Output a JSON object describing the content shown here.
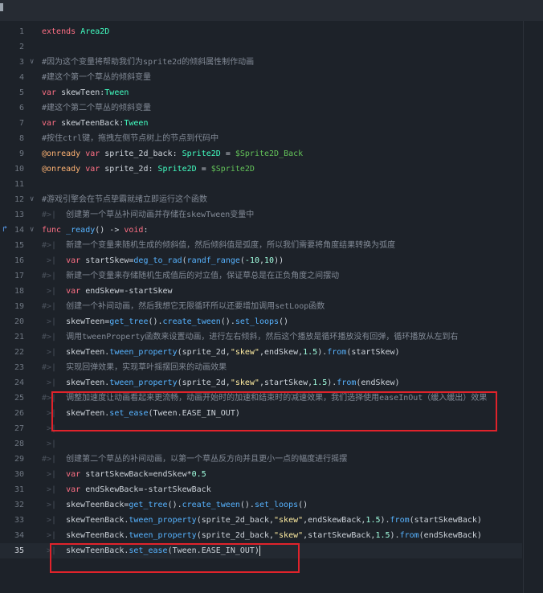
{
  "colors": {
    "background": "#1d2229",
    "keyword": "#ff7085",
    "type": "#42ffc2",
    "comment": "#828a96",
    "function": "#57b3ff",
    "number": "#a1ffe0",
    "string": "#ffeda1",
    "annotation": "#ffb373",
    "annotation_box": "#e0232b"
  },
  "editor": {
    "current_line": 35,
    "breakpoint_icon": "method-override-icon",
    "lines": [
      {
        "n": "1",
        "tokens": [
          [
            "kw",
            "extends"
          ],
          [
            "id",
            " "
          ],
          [
            "type",
            "Area2D"
          ]
        ]
      },
      {
        "n": "2",
        "tokens": []
      },
      {
        "n": "3",
        "fold": "down",
        "tokens": [
          [
            "comment",
            "#因为这个变量将帮助我们为sprite2d的倾斜属性制作动画"
          ]
        ]
      },
      {
        "n": "4",
        "tokens": [
          [
            "comment",
            "#建这个第一个草丛的倾斜变量"
          ]
        ]
      },
      {
        "n": "5",
        "tokens": [
          [
            "kw",
            "var"
          ],
          [
            "id",
            " skewTeen:"
          ],
          [
            "type",
            "Tween"
          ]
        ]
      },
      {
        "n": "6",
        "tokens": [
          [
            "comment",
            "#建这个第二个草丛的倾斜变量"
          ]
        ]
      },
      {
        "n": "7",
        "tokens": [
          [
            "kw",
            "var"
          ],
          [
            "id",
            " skewTeenBack:"
          ],
          [
            "type",
            "Tween"
          ]
        ]
      },
      {
        "n": "8",
        "tokens": [
          [
            "comment",
            "#按住ctrl键，拖拽左侧节点树上的节点到代码中"
          ]
        ]
      },
      {
        "n": "9",
        "tokens": [
          [
            "ann",
            "@onready"
          ],
          [
            "id",
            " "
          ],
          [
            "kw",
            "var"
          ],
          [
            "id",
            " sprite_2d_back: "
          ],
          [
            "type",
            "Sprite2D"
          ],
          [
            "id",
            " = "
          ],
          [
            "node",
            "$Sprite2D_Back"
          ]
        ]
      },
      {
        "n": "10",
        "tokens": [
          [
            "ann",
            "@onready"
          ],
          [
            "id",
            " "
          ],
          [
            "kw",
            "var"
          ],
          [
            "id",
            " sprite_2d: "
          ],
          [
            "type",
            "Sprite2D"
          ],
          [
            "id",
            " = "
          ],
          [
            "node",
            "$Sprite2D"
          ]
        ]
      },
      {
        "n": "11",
        "tokens": []
      },
      {
        "n": "12",
        "fold": "down",
        "tokens": [
          [
            "comment",
            "#游戏引擎会在节点挚霸就绪立即运行这个函数"
          ]
        ]
      },
      {
        "n": "13",
        "tab": true,
        "tokens": [
          [
            "comment",
            "创建第一个草丛补间动画并存储在skewTween变量中"
          ]
        ]
      },
      {
        "n": "14",
        "fold": "down",
        "icon": true,
        "tokens": [
          [
            "kw",
            "func"
          ],
          [
            "id",
            " "
          ],
          [
            "func",
            "_ready"
          ],
          [
            "id",
            "() -> "
          ],
          [
            "kw",
            "void"
          ],
          [
            "id",
            ":"
          ]
        ]
      },
      {
        "n": "15",
        "tab": true,
        "tokens": [
          [
            "comment",
            "新建一个变量来随机生成的倾斜值，然后倾斜值是弧度，所以我们需要将角度结果转换为弧度"
          ]
        ]
      },
      {
        "n": "16",
        "tab": true,
        "tokens": [
          [
            "kw",
            "var"
          ],
          [
            "id",
            " startSkew="
          ],
          [
            "func",
            "deg_to_rad"
          ],
          [
            "id",
            "("
          ],
          [
            "func",
            "randf_range"
          ],
          [
            "id",
            "("
          ],
          [
            "num",
            "-10"
          ],
          [
            "id",
            ","
          ],
          [
            "num",
            "10"
          ],
          [
            "id",
            "))"
          ]
        ]
      },
      {
        "n": "17",
        "tab": true,
        "tokens": [
          [
            "comment",
            "新建一个变量来存储随机生成值后的对立值，保证草总是在正负角度之间摆动"
          ]
        ]
      },
      {
        "n": "18",
        "tab": true,
        "tokens": [
          [
            "kw",
            "var"
          ],
          [
            "id",
            " endSkew=-startSkew"
          ]
        ]
      },
      {
        "n": "19",
        "tab": true,
        "tokens": [
          [
            "comment",
            "创建一个补间动画，然后我想它无限循环所以还要增加调用setLoop函数"
          ]
        ]
      },
      {
        "n": "20",
        "tab": true,
        "tokens": [
          [
            "id",
            "skewTeen="
          ],
          [
            "func",
            "get_tree"
          ],
          [
            "id",
            "()."
          ],
          [
            "func",
            "create_tween"
          ],
          [
            "id",
            "()."
          ],
          [
            "func",
            "set_loops"
          ],
          [
            "id",
            "()"
          ]
        ]
      },
      {
        "n": "21",
        "tab": true,
        "tokens": [
          [
            "comment",
            "调用tweenProperty函数来设置动画，进行左右倾斜，然后这个播放是循环播放没有回弹，循环播放从左到右"
          ]
        ]
      },
      {
        "n": "22",
        "tab": true,
        "tokens": [
          [
            "id",
            "skewTeen."
          ],
          [
            "func",
            "tween_property"
          ],
          [
            "id",
            "(sprite_2d,"
          ],
          [
            "str",
            "\"skew\""
          ],
          [
            "id",
            ",endSkew,"
          ],
          [
            "num",
            "1.5"
          ],
          [
            "id",
            ")."
          ],
          [
            "func",
            "from"
          ],
          [
            "id",
            "(startSkew)"
          ]
        ]
      },
      {
        "n": "23",
        "tab": true,
        "tokens": [
          [
            "comment",
            "实现回弹效果，实现草叶摇摆回来的动画效果"
          ]
        ]
      },
      {
        "n": "24",
        "tab": true,
        "tokens": [
          [
            "id",
            "skewTeen."
          ],
          [
            "func",
            "tween_property"
          ],
          [
            "id",
            "(sprite_2d,"
          ],
          [
            "str",
            "\"skew\""
          ],
          [
            "id",
            ",startSkew,"
          ],
          [
            "num",
            "1.5"
          ],
          [
            "id",
            ")."
          ],
          [
            "func",
            "from"
          ],
          [
            "id",
            "(endSkew)"
          ]
        ]
      },
      {
        "n": "25",
        "tab": true,
        "tokens": [
          [
            "comment",
            "调整加速度让动画看起来更流畅，动画开始时的加速和结束时的减速效果，我们选择使用easeInOut（缓入缓出）效果"
          ]
        ]
      },
      {
        "n": "26",
        "tab": true,
        "tokens": [
          [
            "id",
            "skewTeen."
          ],
          [
            "func",
            "set_ease"
          ],
          [
            "id",
            "(Tween.EASE_IN_OUT)"
          ]
        ]
      },
      {
        "n": "27",
        "tab": true,
        "tokens": []
      },
      {
        "n": "28",
        "tab": true,
        "tokens": []
      },
      {
        "n": "29",
        "tab": true,
        "tokens": [
          [
            "comment",
            "创建第二个草丛的补间动画，以第一个草丛反方向并且更小一点的幅度进行摇摆"
          ]
        ]
      },
      {
        "n": "30",
        "tab": true,
        "tokens": [
          [
            "kw",
            "var"
          ],
          [
            "id",
            " startSkewBack=endSkew*"
          ],
          [
            "num",
            "0.5"
          ]
        ]
      },
      {
        "n": "31",
        "tab": true,
        "tokens": [
          [
            "kw",
            "var"
          ],
          [
            "id",
            " endSkewBack=-startSkewBack"
          ]
        ]
      },
      {
        "n": "32",
        "tab": true,
        "tokens": [
          [
            "id",
            "skewTeenBack="
          ],
          [
            "func",
            "get_tree"
          ],
          [
            "id",
            "()."
          ],
          [
            "func",
            "create_tween"
          ],
          [
            "id",
            "()."
          ],
          [
            "func",
            "set_loops"
          ],
          [
            "id",
            "()"
          ]
        ]
      },
      {
        "n": "33",
        "tab": true,
        "tokens": [
          [
            "id",
            "skewTeenBack."
          ],
          [
            "func",
            "tween_property"
          ],
          [
            "id",
            "(sprite_2d_back,"
          ],
          [
            "str",
            "\"skew\""
          ],
          [
            "id",
            ",endSkewBack,"
          ],
          [
            "num",
            "1.5"
          ],
          [
            "id",
            ")."
          ],
          [
            "func",
            "from"
          ],
          [
            "id",
            "(startSkewBack)"
          ]
        ]
      },
      {
        "n": "34",
        "tab": true,
        "tokens": [
          [
            "id",
            "skewTeenBack."
          ],
          [
            "func",
            "tween_property"
          ],
          [
            "id",
            "(sprite_2d_back,"
          ],
          [
            "str",
            "\"skew\""
          ],
          [
            "id",
            ",startSkewBack,"
          ],
          [
            "num",
            "1.5"
          ],
          [
            "id",
            ")."
          ],
          [
            "func",
            "from"
          ],
          [
            "id",
            "(endSkewBack)"
          ]
        ]
      },
      {
        "n": "35",
        "tab": true,
        "cursor": true,
        "tokens": [
          [
            "id",
            "skewTeenBack."
          ],
          [
            "func",
            "set_ease"
          ],
          [
            "id",
            "(Tween.EASE_IN_OUT)"
          ]
        ]
      }
    ]
  }
}
